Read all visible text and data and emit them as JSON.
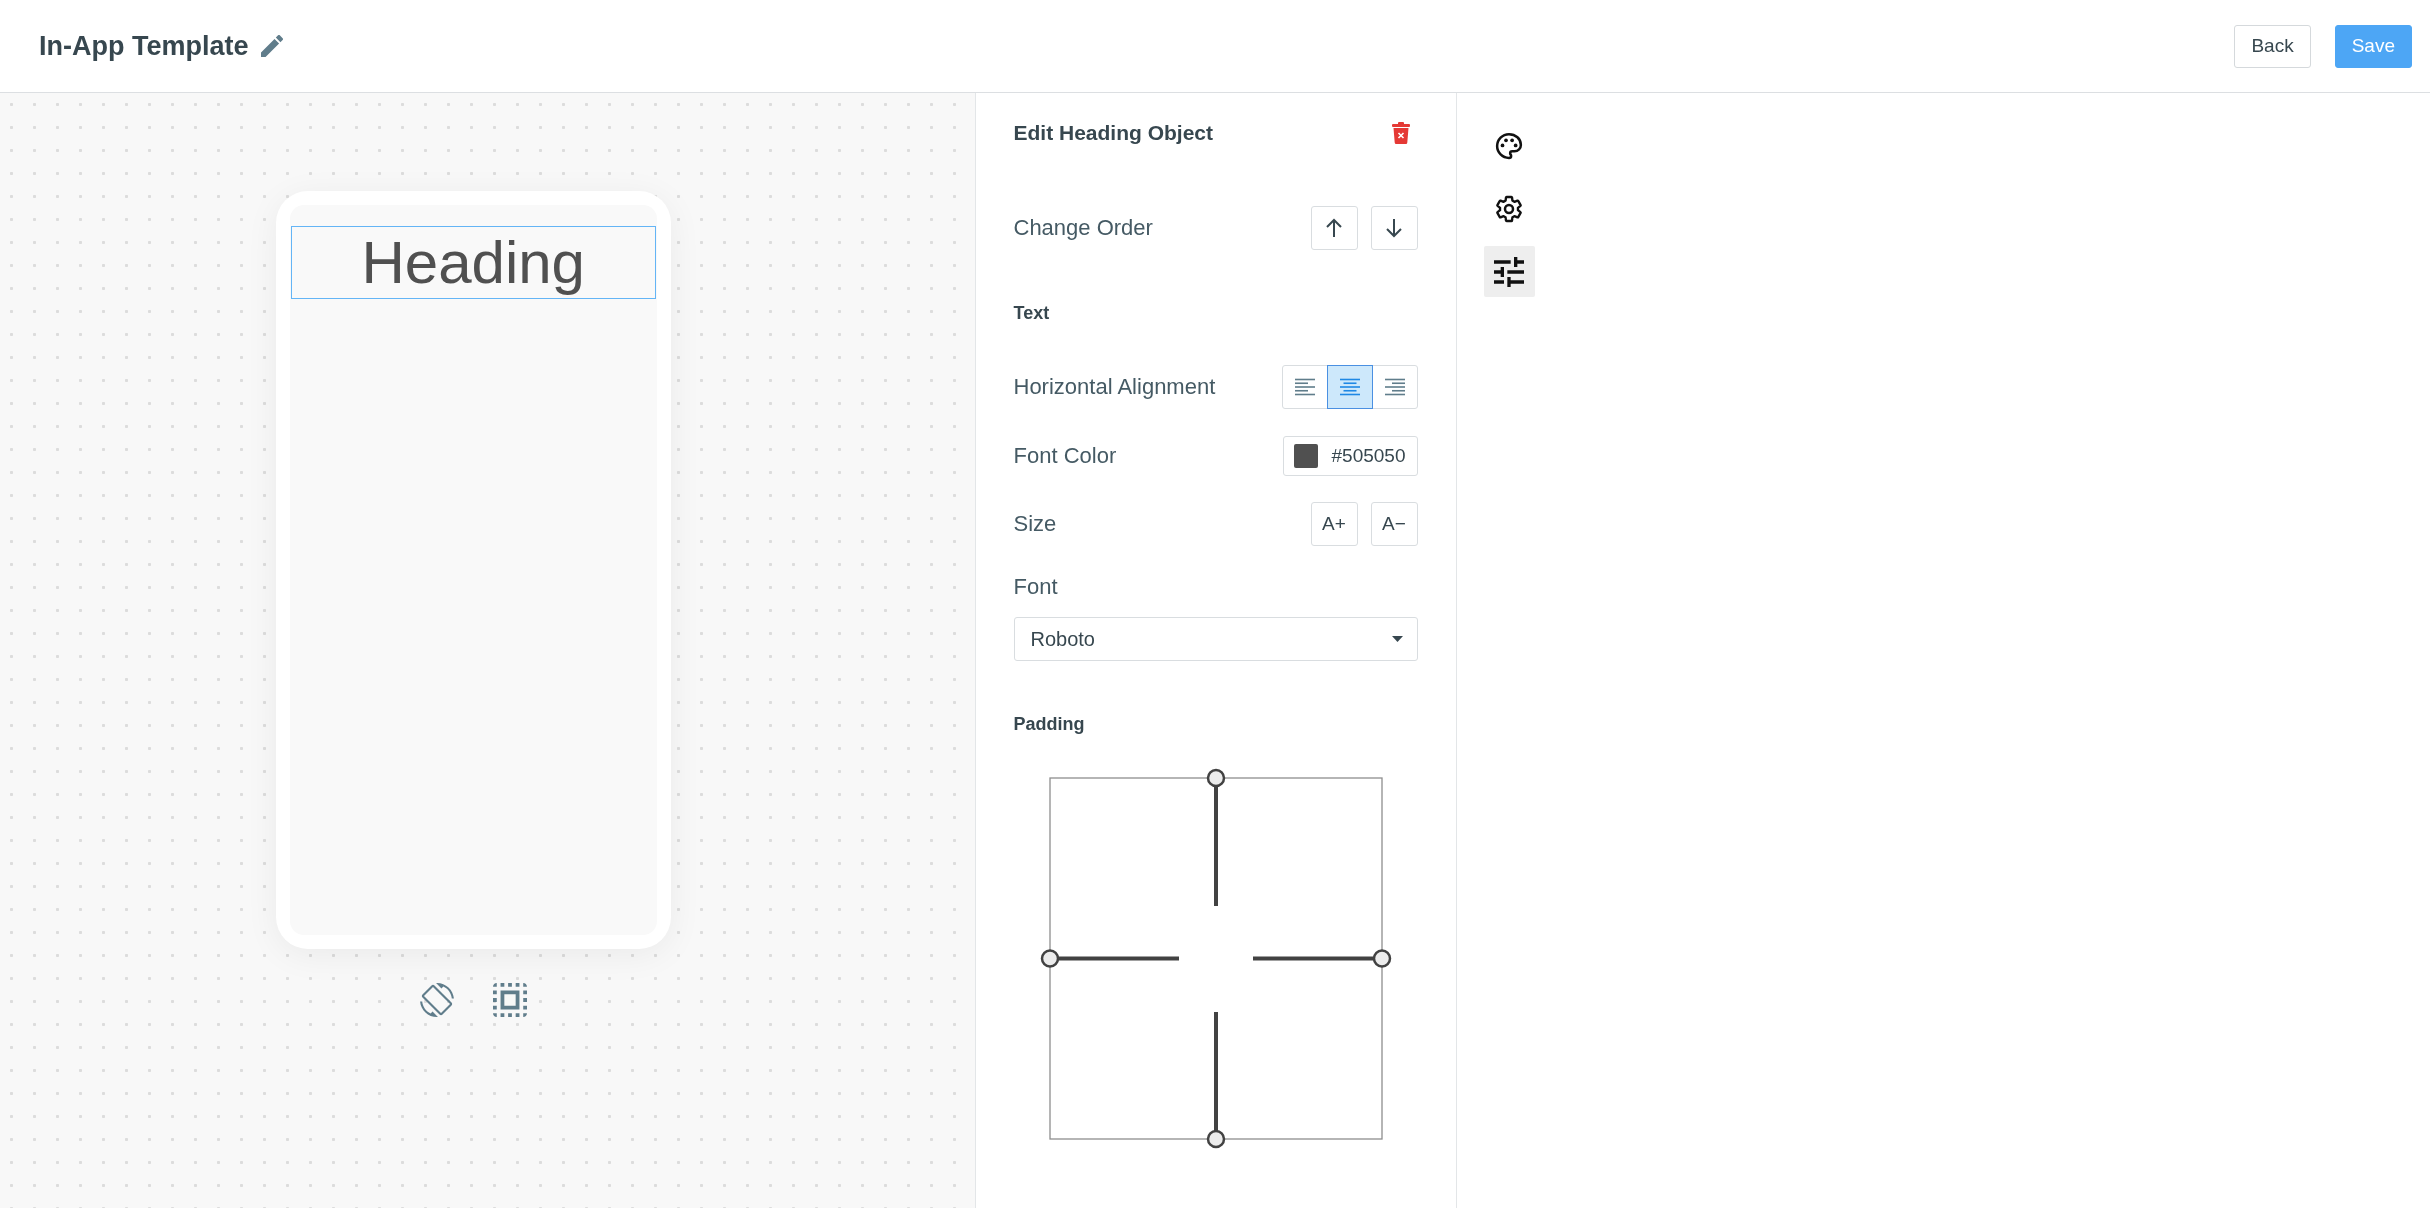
{
  "header": {
    "title": "In-App Template",
    "buttons": [
      {
        "label": "Back",
        "kind": "secondary"
      },
      {
        "label": "Save",
        "kind": "primary"
      }
    ]
  },
  "canvas": {
    "heading": {
      "text": "Heading",
      "selected": true
    }
  },
  "panel": {
    "title": "Edit Heading Object",
    "change_order": {
      "label": "Change Order"
    },
    "text": {
      "title": "Text",
      "alignment": {
        "label": "Horizontal Alignment",
        "options": [
          {
            "kind": "left",
            "selected": false
          },
          {
            "kind": "center",
            "selected": true
          },
          {
            "kind": "right",
            "selected": false
          }
        ]
      },
      "font_color": {
        "label": "Font Color",
        "value": "#505050"
      },
      "size": {
        "label": "Size",
        "buttons": [
          "A+",
          "A−"
        ]
      },
      "font": {
        "label": "Font",
        "value": "Roboto"
      }
    },
    "padding": {
      "title": "Padding"
    }
  },
  "tool_strip": [
    {
      "kind": "palette",
      "selected": false
    },
    {
      "kind": "settings",
      "selected": false
    },
    {
      "kind": "sliders",
      "selected": true
    }
  ]
}
